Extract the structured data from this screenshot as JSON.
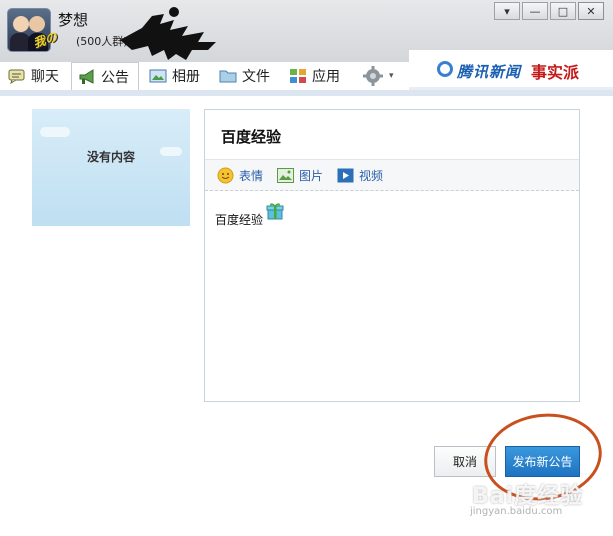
{
  "header": {
    "group_name": "梦想",
    "member_count": "(500人群)",
    "avatar_badge": "我の"
  },
  "window_controls": [
    {
      "name": "menu-button",
      "glyph": "▾"
    },
    {
      "name": "minimize-button",
      "glyph": "—"
    },
    {
      "name": "maximize-button",
      "glyph": "□"
    },
    {
      "name": "close-button",
      "glyph": "✕"
    }
  ],
  "tabs": [
    {
      "label": "聊天",
      "icon": "chat-icon"
    },
    {
      "label": "公告",
      "icon": "megaphone-icon",
      "active": true
    },
    {
      "label": "相册",
      "icon": "photo-album-icon"
    },
    {
      "label": "文件",
      "icon": "folder-icon"
    },
    {
      "label": "应用",
      "icon": "apps-icon"
    },
    {
      "label": "",
      "icon": "gear-icon"
    }
  ],
  "banner": {
    "brand": "腾讯新闻",
    "sub": "事实派"
  },
  "sidebar": {
    "empty_label": "没有内容"
  },
  "editor": {
    "title": "百度经验",
    "toolbar": [
      {
        "label": "表情",
        "icon": "emoji-icon"
      },
      {
        "label": "图片",
        "icon": "image-icon"
      },
      {
        "label": "视频",
        "icon": "video-icon"
      }
    ],
    "body": "百度经验"
  },
  "actions": {
    "cancel": "取消",
    "publish": "发布新公告"
  },
  "watermark": {
    "big": "Bai度经验",
    "small": "jingyan.baidu.com"
  },
  "colors": {
    "accent": "#1e73c2",
    "highlight_circle": "#c8501e",
    "link": "#2a5ea8"
  }
}
